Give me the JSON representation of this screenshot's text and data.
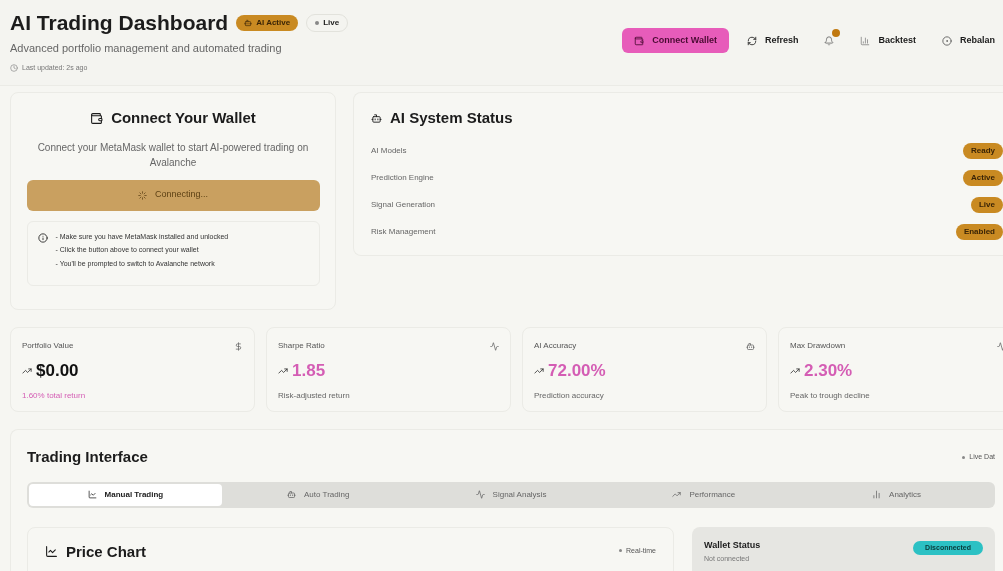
{
  "header": {
    "title": "AI Trading Dashboard",
    "ai_badge": "AI Active",
    "live_badge": "Live",
    "subtitle": "Advanced portfolio management and automated trading",
    "last_updated": "Last updated: 2s ago"
  },
  "toolbar": {
    "connect": "Connect Wallet",
    "refresh": "Refresh",
    "notifications": {
      "unread": true
    },
    "backtest": "Backtest",
    "rebalance": "Rebalan"
  },
  "connect_card": {
    "title": "Connect Your Wallet",
    "description": "Connect your MetaMask wallet to start AI-powered trading on Avalanche",
    "button": {
      "label": "Connecting...",
      "disabled": true
    },
    "tips": [
      "- Make sure you have MetaMask installed and unlocked",
      "- Click the button above to connect your wallet",
      "- You'll be prompted to switch to Avalanche network"
    ]
  },
  "ai_status": {
    "title": "AI System Status",
    "rows": [
      {
        "label": "AI Models",
        "status": "Ready"
      },
      {
        "label": "Prediction Engine",
        "status": "Active"
      },
      {
        "label": "Signal Generation",
        "status": "Live"
      },
      {
        "label": "Risk Management",
        "status": "Enabled"
      }
    ]
  },
  "metrics": [
    {
      "label": "Portfolio Value",
      "value": "$0.00",
      "note": "1.60% total return",
      "kind": "primary"
    },
    {
      "label": "Sharpe Ratio",
      "value": "1.85",
      "note": "Risk-adjusted return",
      "kind": "secondary"
    },
    {
      "label": "AI Accuracy",
      "value": "72.00%",
      "note": "Prediction accuracy",
      "kind": "secondary"
    },
    {
      "label": "Max Drawdown",
      "value": "2.30%",
      "note": "Peak to trough decline",
      "kind": "secondary"
    }
  ],
  "trading": {
    "title": "Trading Interface",
    "live_label": "Live Dat",
    "tabs": [
      {
        "label": "Manual Trading",
        "selected": true
      },
      {
        "label": "Auto Trading",
        "selected": false
      },
      {
        "label": "Signal Analysis",
        "selected": false
      },
      {
        "label": "Performance",
        "selected": false
      },
      {
        "label": "Analytics",
        "selected": false
      }
    ],
    "price_chart": {
      "title": "Price Chart",
      "badge": "Real-time"
    },
    "wallet_status": {
      "title": "Wallet Status",
      "subtitle": "Not connected",
      "badge": "Disconnected",
      "connected": false
    }
  }
}
